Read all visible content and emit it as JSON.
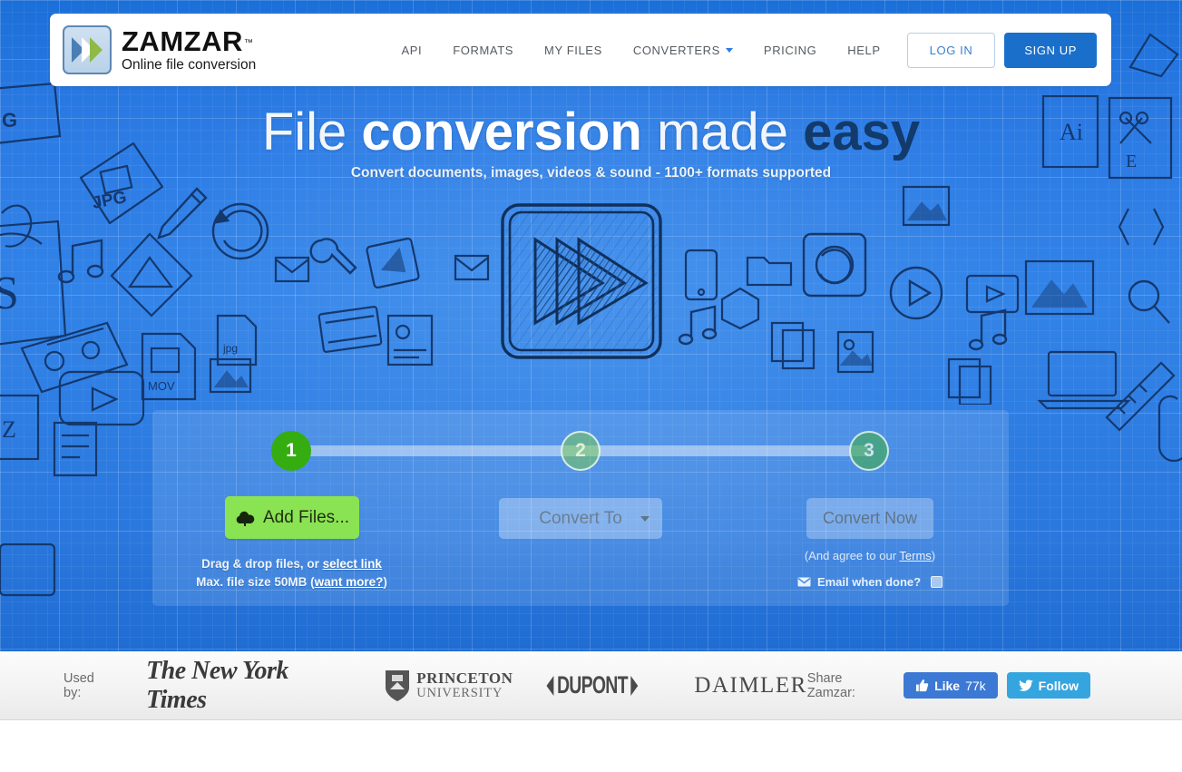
{
  "brand": {
    "name": "ZAMZAR",
    "tm": "™",
    "tagline": "Online file conversion",
    "icon": "zamzar-chevrons-logo"
  },
  "nav": {
    "items": [
      {
        "label": "API",
        "icon": null
      },
      {
        "label": "FORMATS",
        "icon": null
      },
      {
        "label": "MY FILES",
        "icon": null
      },
      {
        "label": "CONVERTERS",
        "icon": "caret-down-icon"
      },
      {
        "label": "PRICING",
        "icon": null
      },
      {
        "label": "HELP",
        "icon": null
      }
    ],
    "login_label": "LOG IN",
    "signup_label": "SIGN UP"
  },
  "hero": {
    "headline_part1": "File ",
    "headline_part2": "conversion",
    "headline_part3": " made ",
    "headline_part4": "easy",
    "subheadline": "Convert documents, images, videos & sound - 1100+ formats supported",
    "illustration": "fast-forward-chevrons-sketch"
  },
  "converter": {
    "steps": [
      {
        "number": "1",
        "state": "active"
      },
      {
        "number": "2",
        "state": "inactive"
      },
      {
        "number": "3",
        "state": "inactive"
      }
    ],
    "step1": {
      "button_label": "Add Files...",
      "button_icon": "cloud-upload-icon",
      "hint_line1_prefix": "Drag & drop files, or ",
      "hint_line1_link": "select link",
      "hint_line2_prefix": "Max. file size 50MB (",
      "hint_line2_link": "want more?",
      "hint_line2_suffix": ")"
    },
    "step2": {
      "select_value": "Convert To",
      "select_icon": "chevron-down-icon"
    },
    "step3": {
      "button_label": "Convert Now",
      "terms_prefix": "(And agree to our ",
      "terms_link": "Terms",
      "terms_suffix": ")",
      "email_icon": "envelope-icon",
      "email_label": "Email when done?",
      "email_checked": false
    }
  },
  "footer": {
    "used_by_label": "Used by:",
    "logos": [
      {
        "name": "The New York Times"
      },
      {
        "name": "PRINCETON",
        "sub": "UNIVERSITY"
      },
      {
        "name": "DUPONT"
      },
      {
        "name": "DAIMLER"
      }
    ],
    "share_label": "Share Zamzar:",
    "like_label": "Like",
    "like_count": "77k",
    "like_icon": "thumbs-up-icon",
    "follow_label": "Follow",
    "follow_icon": "twitter-bird-icon"
  },
  "colors": {
    "blueprint_blue": "#2b7ae4",
    "brand_blue": "#1a6fcb",
    "green_accent": "#35ad11",
    "addfiles_green": "#8ae352",
    "headline_dark": "#123a6b",
    "facebook_blue": "#3b79d4",
    "twitter_blue": "#35a5e0"
  }
}
